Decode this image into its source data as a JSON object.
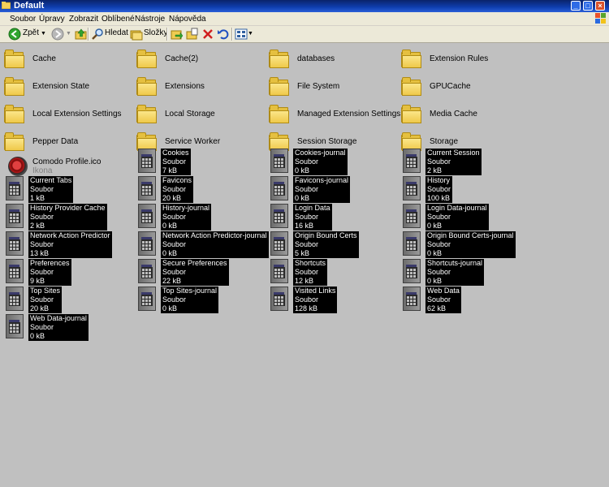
{
  "window": {
    "title": "Default"
  },
  "menu": [
    "Soubor",
    "Úpravy",
    "Zobrazit",
    "Oblíbené",
    "Nástroje",
    "Nápověda"
  ],
  "toolbar": {
    "back_label": "Zpět",
    "search_label": "Hledat",
    "folders_label": "Složky"
  },
  "folders": [
    "Cache",
    "Cache(2)",
    "databases",
    "Extension Rules",
    "Extension State",
    "Extensions",
    "File System",
    "GPUCache",
    "Local Extension Settings",
    "Local Storage",
    "Managed Extension Settings",
    "Media Cache",
    "Pepper Data",
    "Service Worker",
    "Session Storage",
    "Storage"
  ],
  "icon_file": {
    "name": "Comodo Profile.ico",
    "type": "Ikona"
  },
  "files": [
    {
      "name": "Cookies",
      "type": "Soubor",
      "size": "7 kB"
    },
    {
      "name": "Cookies-journal",
      "type": "Soubor",
      "size": "0 kB"
    },
    {
      "name": "Current Session",
      "type": "Soubor",
      "size": "2 kB"
    },
    {
      "name": "Current Tabs",
      "type": "Soubor",
      "size": "1 kB"
    },
    {
      "name": "Favicons",
      "type": "Soubor",
      "size": "20 kB"
    },
    {
      "name": "Favicons-journal",
      "type": "Soubor",
      "size": "0 kB"
    },
    {
      "name": "History",
      "type": "Soubor",
      "size": "100 kB"
    },
    {
      "name": "History Provider Cache",
      "type": "Soubor",
      "size": "2 kB"
    },
    {
      "name": "History-journal",
      "type": "Soubor",
      "size": "0 kB"
    },
    {
      "name": "Login Data",
      "type": "Soubor",
      "size": "16 kB"
    },
    {
      "name": "Login Data-journal",
      "type": "Soubor",
      "size": "0 kB"
    },
    {
      "name": "Network Action Predictor",
      "type": "Soubor",
      "size": "13 kB"
    },
    {
      "name": "Network Action Predictor-journal",
      "type": "Soubor",
      "size": "0 kB"
    },
    {
      "name": "Origin Bound Certs",
      "type": "Soubor",
      "size": "5 kB"
    },
    {
      "name": "Origin Bound Certs-journal",
      "type": "Soubor",
      "size": "0 kB"
    },
    {
      "name": "Preferences",
      "type": "Soubor",
      "size": "9 kB"
    },
    {
      "name": "Secure Preferences",
      "type": "Soubor",
      "size": "22 kB"
    },
    {
      "name": "Shortcuts",
      "type": "Soubor",
      "size": "12 kB"
    },
    {
      "name": "Shortcuts-journal",
      "type": "Soubor",
      "size": "0 kB"
    },
    {
      "name": "Top Sites",
      "type": "Soubor",
      "size": "20 kB"
    },
    {
      "name": "Top Sites-journal",
      "type": "Soubor",
      "size": "0 kB"
    },
    {
      "name": "Visited Links",
      "type": "Soubor",
      "size": "128 kB"
    },
    {
      "name": "Web Data",
      "type": "Soubor",
      "size": "62 kB"
    },
    {
      "name": "Web Data-journal",
      "type": "Soubor",
      "size": "0 kB"
    }
  ]
}
